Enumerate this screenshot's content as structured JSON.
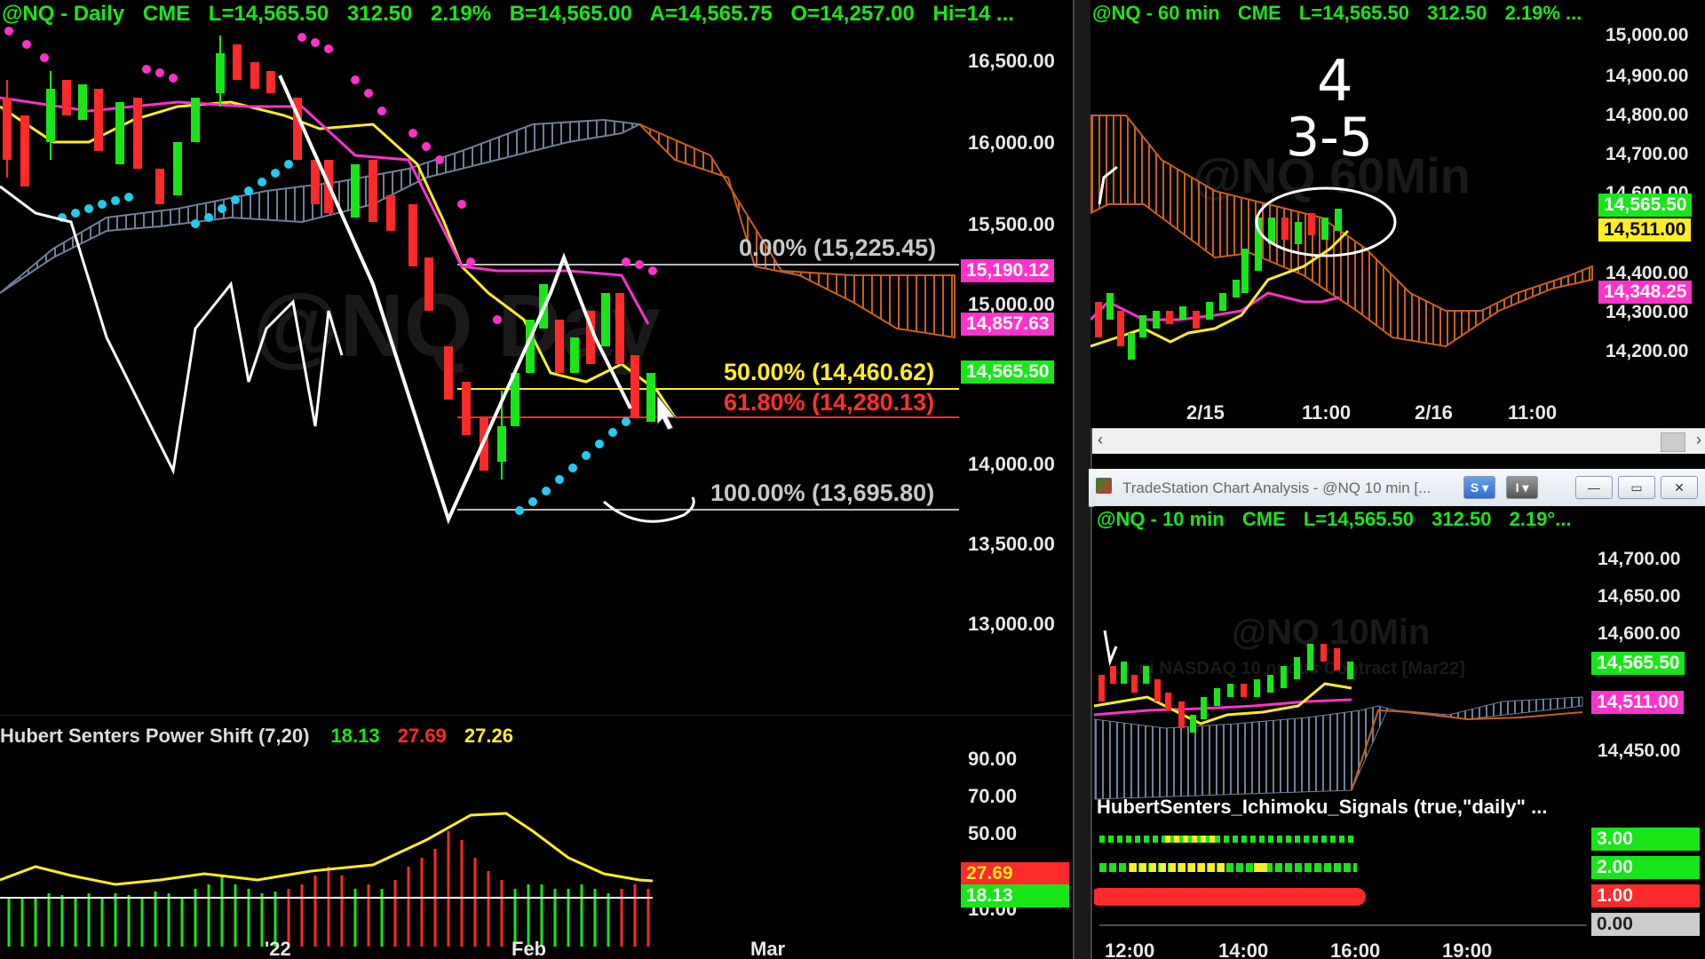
{
  "colors": {
    "up": "#19e619",
    "down": "#ff2a2a",
    "magenta": "#ff33cc",
    "cyan": "#22ccee",
    "yellow": "#ffee22",
    "white": "#ffffff",
    "cloud_orange": "#c8601c",
    "cloud_slate": "#6f7f99"
  },
  "daily": {
    "header": {
      "symbol": "@NQ - Daily",
      "exchange": "CME",
      "last": "L=14,565.50",
      "change": "312.50",
      "pct": "2.19%",
      "bid": "B=14,565.00",
      "ask": "A=14,565.75",
      "open": "O=14,257.00",
      "hi": "Hi=14 ..."
    },
    "watermark": "@NQ Day",
    "price_axis": [
      "16,500.00",
      "16,000.00",
      "15,500.00",
      "15,000.00",
      "14,000.00",
      "13,500.00",
      "13,000.00"
    ],
    "price_tags": [
      {
        "text": "15,190.12",
        "color": "magenta"
      },
      {
        "text": "14,857.63",
        "color": "magenta"
      },
      {
        "text": "14,565.50",
        "color": "up"
      }
    ],
    "fib_levels": [
      {
        "text": "0.00% (15,225.45)",
        "color": "#c8c8c8"
      },
      {
        "text": "50.00% (14,460.62)",
        "color": "#ffee22"
      },
      {
        "text": "61.80% (14,280.13)",
        "color": "#ff3030"
      },
      {
        "text": "100.00% (13,695.80)",
        "color": "#c8c8c8"
      }
    ],
    "x_axis": [
      "'22",
      "Feb",
      "Mar"
    ]
  },
  "power_shift": {
    "title": "Hubert Senters Power Shift (7,20)",
    "values": [
      "18.13",
      "27.69",
      "27.26"
    ],
    "axis": [
      "90.00",
      "70.00",
      "50.00",
      "10.00"
    ],
    "tags": [
      "27.69",
      "18.13"
    ]
  },
  "sixty": {
    "header": {
      "symbol": "@NQ - 60 min",
      "exchange": "CME",
      "last": "L=14,565.50",
      "change": "312.50",
      "pct": "2.19% ..."
    },
    "watermark": "@NQ 60Min",
    "price_axis": [
      "15,000.00",
      "14,900.00",
      "14,800.00",
      "14,700.00",
      "14,600.00",
      "14,400.00",
      "14,300.00",
      "14,200.00"
    ],
    "price_tags": [
      "14,565.50",
      "14,511.00",
      "14,348.25"
    ],
    "x_axis": [
      "2/15",
      "11:00",
      "2/16",
      "11:00"
    ],
    "annotation": [
      "4",
      "3-5"
    ]
  },
  "ten": {
    "window_title": "TradeStation Chart Analysis - @NQ 10 min [...",
    "btn_s": "S",
    "btn_i": "I",
    "header": {
      "symbol": "@NQ - 10 min",
      "exchange": "CME",
      "last": "L=14,565.50",
      "change": "312.50",
      "pct": "2.19°..."
    },
    "watermark": "@NQ 10Min",
    "sub_watermark": "ni NASDAQ 10    nuous Contract [Mar22]",
    "price_axis": [
      "14,700.00",
      "14,650.00",
      "14,600.00",
      "14,450.00"
    ],
    "price_tags": [
      "14,565.50",
      "14,511.00"
    ],
    "signals_title": "HubertSenters_Ichimoku_Signals (true,\"daily\" ...",
    "signal_tags": [
      "3.00",
      "2.00",
      "1.00",
      "0.00"
    ],
    "x_axis": [
      "12:00",
      "14:00",
      "16:00",
      "19:00"
    ]
  }
}
